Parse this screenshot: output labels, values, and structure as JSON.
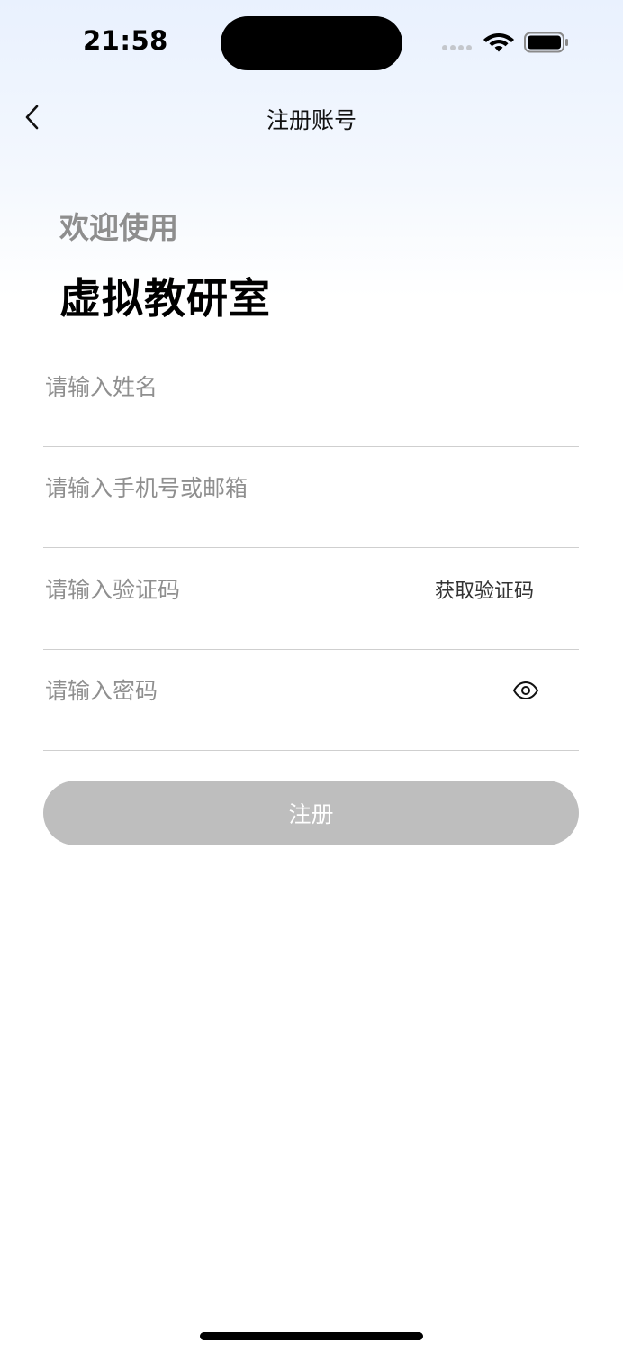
{
  "status_bar": {
    "time": "21:58",
    "icons": [
      "signal-icon",
      "wifi-icon",
      "battery-icon"
    ]
  },
  "nav": {
    "back_icon": "chevron-left-icon",
    "title": "注册账号"
  },
  "welcome": {
    "greeting": "欢迎使用",
    "app_name": "虚拟教研室"
  },
  "form": {
    "name_placeholder": "请输入姓名",
    "name_value": "",
    "contact_placeholder": "请输入手机号或邮箱",
    "contact_value": "",
    "code_placeholder": "请输入验证码",
    "code_value": "",
    "get_code_label": "获取验证码",
    "password_placeholder": "请输入密码",
    "password_value": "",
    "password_toggle_icon": "eye-icon",
    "submit_label": "注册",
    "submit_disabled_color": "#bebebe"
  }
}
